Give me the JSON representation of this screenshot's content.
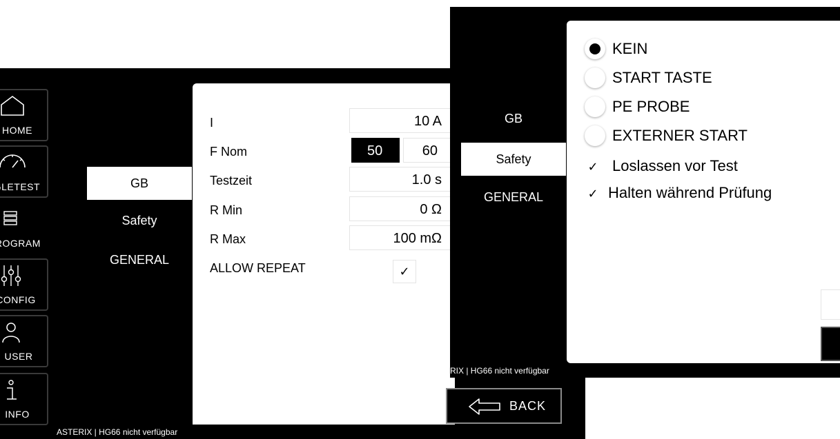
{
  "back_window": {
    "sidebar": [
      {
        "label": "HOME",
        "icon": "home-icon"
      },
      {
        "label": "SINGLETEST",
        "icon": "gauge-icon"
      },
      {
        "label": "PROGRAM",
        "icon": "list-icon"
      },
      {
        "label": "CONFIG",
        "icon": "sliders-icon"
      },
      {
        "label": "USER",
        "icon": "user-icon"
      },
      {
        "label": "INFO",
        "icon": "info-icon"
      }
    ],
    "tabs": [
      "GB",
      "Safety",
      "GENERAL"
    ],
    "active_tab": "GB",
    "rows": [
      {
        "label": "I",
        "value": "10  A"
      },
      {
        "label": "F Nom",
        "opt_a": "50",
        "opt_b": "60",
        "selected": "50"
      },
      {
        "label": "Testzeit",
        "value": "1.0  s"
      },
      {
        "label": "R Min",
        "value": "0  Ω"
      },
      {
        "label": "R Max",
        "value": "100 mΩ"
      },
      {
        "label": "ALLOW REPEAT",
        "checked": true
      }
    ],
    "check_mark": "✓",
    "status": "ASTERIX | HG66 nicht verfügbar",
    "back_label": "BACK"
  },
  "front_window": {
    "tabs": [
      "GB",
      "Safety",
      "GENERAL"
    ],
    "active_tab": "Safety",
    "radio_options": [
      "KEIN",
      "START TASTE",
      "PE PROBE",
      "EXTERNER START"
    ],
    "selected_option": "KEIN",
    "checkboxes": [
      {
        "label": "Loslassen vor Test",
        "checked": true
      },
      {
        "label": "Halten während Prüfung",
        "checked": true
      }
    ],
    "check_mark": "✓",
    "status": "RIX | HG66 nicht verfügbar"
  },
  "colors": {
    "background": "#000000",
    "panel": "#ffffff",
    "selected": "#000000"
  }
}
